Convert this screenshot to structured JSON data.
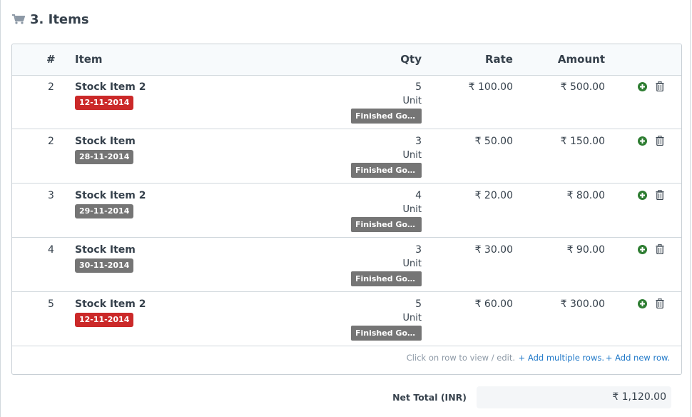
{
  "section": {
    "title": "3. Items",
    "icon": "cart-icon"
  },
  "table": {
    "headers": {
      "index": "#",
      "item": "Item",
      "qty": "Qty",
      "rate": "Rate",
      "amount": "Amount"
    },
    "rows": [
      {
        "idx": "2",
        "name": "Stock Item 2",
        "date": "12-11-2014",
        "date_color": "#cb2929",
        "qty": "5",
        "unit": "Unit",
        "group": "Finished Goods",
        "rate": "₹ 100.00",
        "amount": "₹ 500.00"
      },
      {
        "idx": "2",
        "name": "Stock Item",
        "date": "28-11-2014",
        "date_color": "#757575",
        "qty": "3",
        "unit": "Unit",
        "group": "Finished Goods",
        "rate": "₹ 50.00",
        "amount": "₹ 150.00"
      },
      {
        "idx": "3",
        "name": "Stock Item 2",
        "date": "29-11-2014",
        "date_color": "#757575",
        "qty": "4",
        "unit": "Unit",
        "group": "Finished Goods",
        "rate": "₹ 20.00",
        "amount": "₹ 80.00"
      },
      {
        "idx": "4",
        "name": "Stock Item",
        "date": "30-11-2014",
        "date_color": "#757575",
        "qty": "3",
        "unit": "Unit",
        "group": "Finished Goods",
        "rate": "₹ 30.00",
        "amount": "₹ 90.00"
      },
      {
        "idx": "5",
        "name": "Stock Item 2",
        "date": "12-11-2014",
        "date_color": "#cb2929",
        "qty": "5",
        "unit": "Unit",
        "group": "Finished Goods",
        "rate": "₹ 60.00",
        "amount": "₹ 300.00"
      }
    ],
    "footer": {
      "hint": "Click on row to view / edit.",
      "add_multiple": "+ Add multiple rows.",
      "add_new": "+ Add new row."
    }
  },
  "totals": {
    "net_total_label": "Net Total (INR)",
    "net_total_value": "₹ 1,120.00"
  },
  "colors": {
    "accent_link": "#1f78c8",
    "add_icon": "#2e7d32",
    "group_badge": "#757575"
  }
}
